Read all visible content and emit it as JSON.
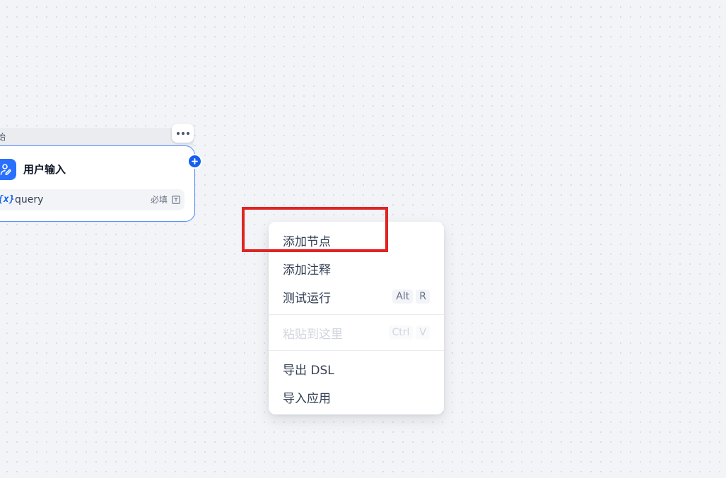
{
  "canvas": {
    "background": "#f2f4f7"
  },
  "start_node": {
    "header_label": "始",
    "title": "用户输入",
    "icon": "user-edit-icon",
    "accent_color": "#2970ff",
    "more_icon": "more-horizontal-icon",
    "add_handle_icon": "plus-icon",
    "variables": [
      {
        "icon_text": "{x}",
        "name": "query",
        "required_label": "必填",
        "type_icon": "text-type-icon"
      }
    ]
  },
  "context_menu": {
    "groups": [
      {
        "items": [
          {
            "label": "添加节点",
            "shortcut": [],
            "disabled": false
          },
          {
            "label": "添加注释",
            "shortcut": [],
            "disabled": false
          },
          {
            "label": "测试运行",
            "shortcut": [
              "Alt",
              "R"
            ],
            "disabled": false
          }
        ]
      },
      {
        "items": [
          {
            "label": "粘贴到这里",
            "shortcut": [
              "Ctrl",
              "V"
            ],
            "disabled": true
          }
        ]
      },
      {
        "items": [
          {
            "label": "导出 DSL",
            "shortcut": [],
            "disabled": false
          },
          {
            "label": "导入应用",
            "shortcut": [],
            "disabled": false
          }
        ]
      }
    ]
  },
  "annotation": {
    "highlight_color": "#e02424"
  }
}
